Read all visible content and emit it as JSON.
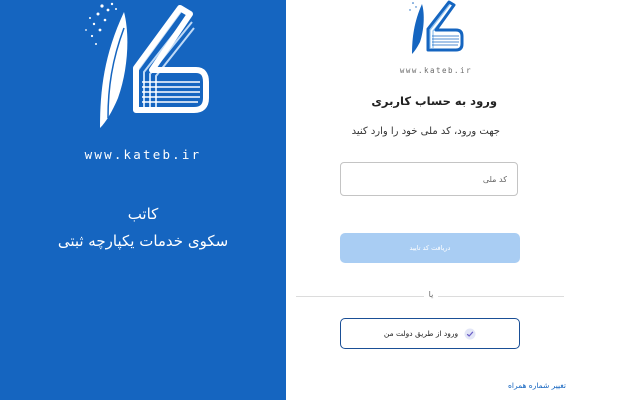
{
  "brand": {
    "url": "www.kateb.ir",
    "name": "کاتب",
    "tagline": "سکوی خدمات یکپارچه ثبتی"
  },
  "login": {
    "logo_url": "www.kateb.ir",
    "title": "ورود به حساب کاربری",
    "subtitle": "جهت ورود، کد ملی خود را وارد کنید",
    "national_code_placeholder": "کد ملی",
    "national_code_value": "",
    "submit_label": "دریافت کد تایید",
    "divider_text": "یا",
    "dolat_label": "ورود از طریق دولت من",
    "change_phone_label": "تغییر شماره همراه"
  },
  "colors": {
    "brand_blue": "#1565c0",
    "disabled_button": "#a9cdf3",
    "outline_button": "#1a4f96"
  },
  "icons": {
    "logo": "kateb-feather-book-logo",
    "dolat": "dolat-man-icon"
  }
}
